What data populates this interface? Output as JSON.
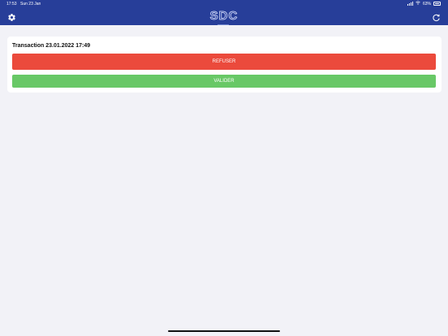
{
  "status_bar": {
    "time": "17:53",
    "date": "Sun 23 Jan",
    "battery": "63%"
  },
  "app": {
    "title": "SDC"
  },
  "header": {
    "settings_icon": "gear-icon",
    "refresh_icon": "refresh-icon"
  },
  "transaction": {
    "title": "Transaction 23.01.2022 17:49",
    "refuse_label": "REFUSER",
    "validate_label": "VALIDER"
  },
  "colors": {
    "header": "#273e99",
    "refuse": "#eb4a3c",
    "validate": "#68c866",
    "background": "#f2f2f7"
  }
}
